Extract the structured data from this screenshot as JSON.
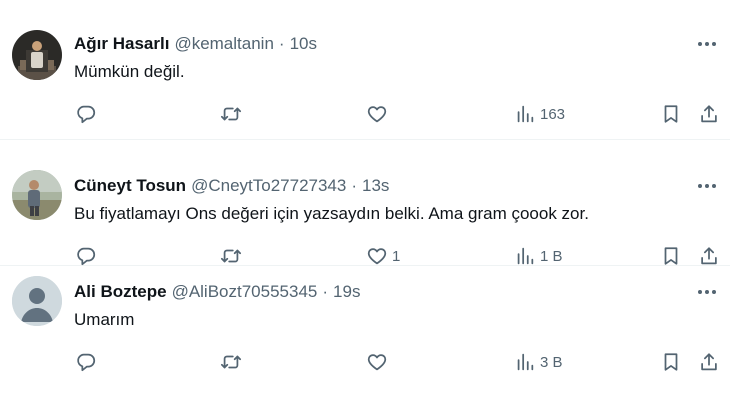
{
  "tweets": [
    {
      "name": "Ağır Hasarlı",
      "handle": "@kemaltanin",
      "separator": "·",
      "time": "10s",
      "text": "Mümkün değil.",
      "avatar": "photo",
      "reply_count": "",
      "retweet_count": "",
      "like_count": "",
      "views": "163"
    },
    {
      "name": "Cüneyt Tosun",
      "handle": "@CneytTo27727343",
      "separator": "·",
      "time": "13s",
      "text": "Bu fiyatlamayı Ons değeri için yazsaydın belki. Ama gram çoook zor.",
      "avatar": "photo",
      "reply_count": "",
      "retweet_count": "",
      "like_count": "1",
      "views": "1 B"
    },
    {
      "name": "Ali Boztepe",
      "handle": "@AliBozt70555345",
      "separator": "·",
      "time": "19s",
      "text": "Umarım",
      "avatar": "default",
      "reply_count": "",
      "retweet_count": "",
      "like_count": "",
      "views": "3 B"
    }
  ],
  "icons": {
    "reply": "reply-icon",
    "retweet": "retweet-icon",
    "like": "heart-icon",
    "views": "views-chart-icon",
    "bookmark": "bookmark-icon",
    "share": "share-icon",
    "more": "more-dots-icon"
  },
  "colors": {
    "text": "#0f1419",
    "secondary": "#536471",
    "divider": "#eff3f4",
    "default_avatar_bg": "#cfd9de"
  }
}
